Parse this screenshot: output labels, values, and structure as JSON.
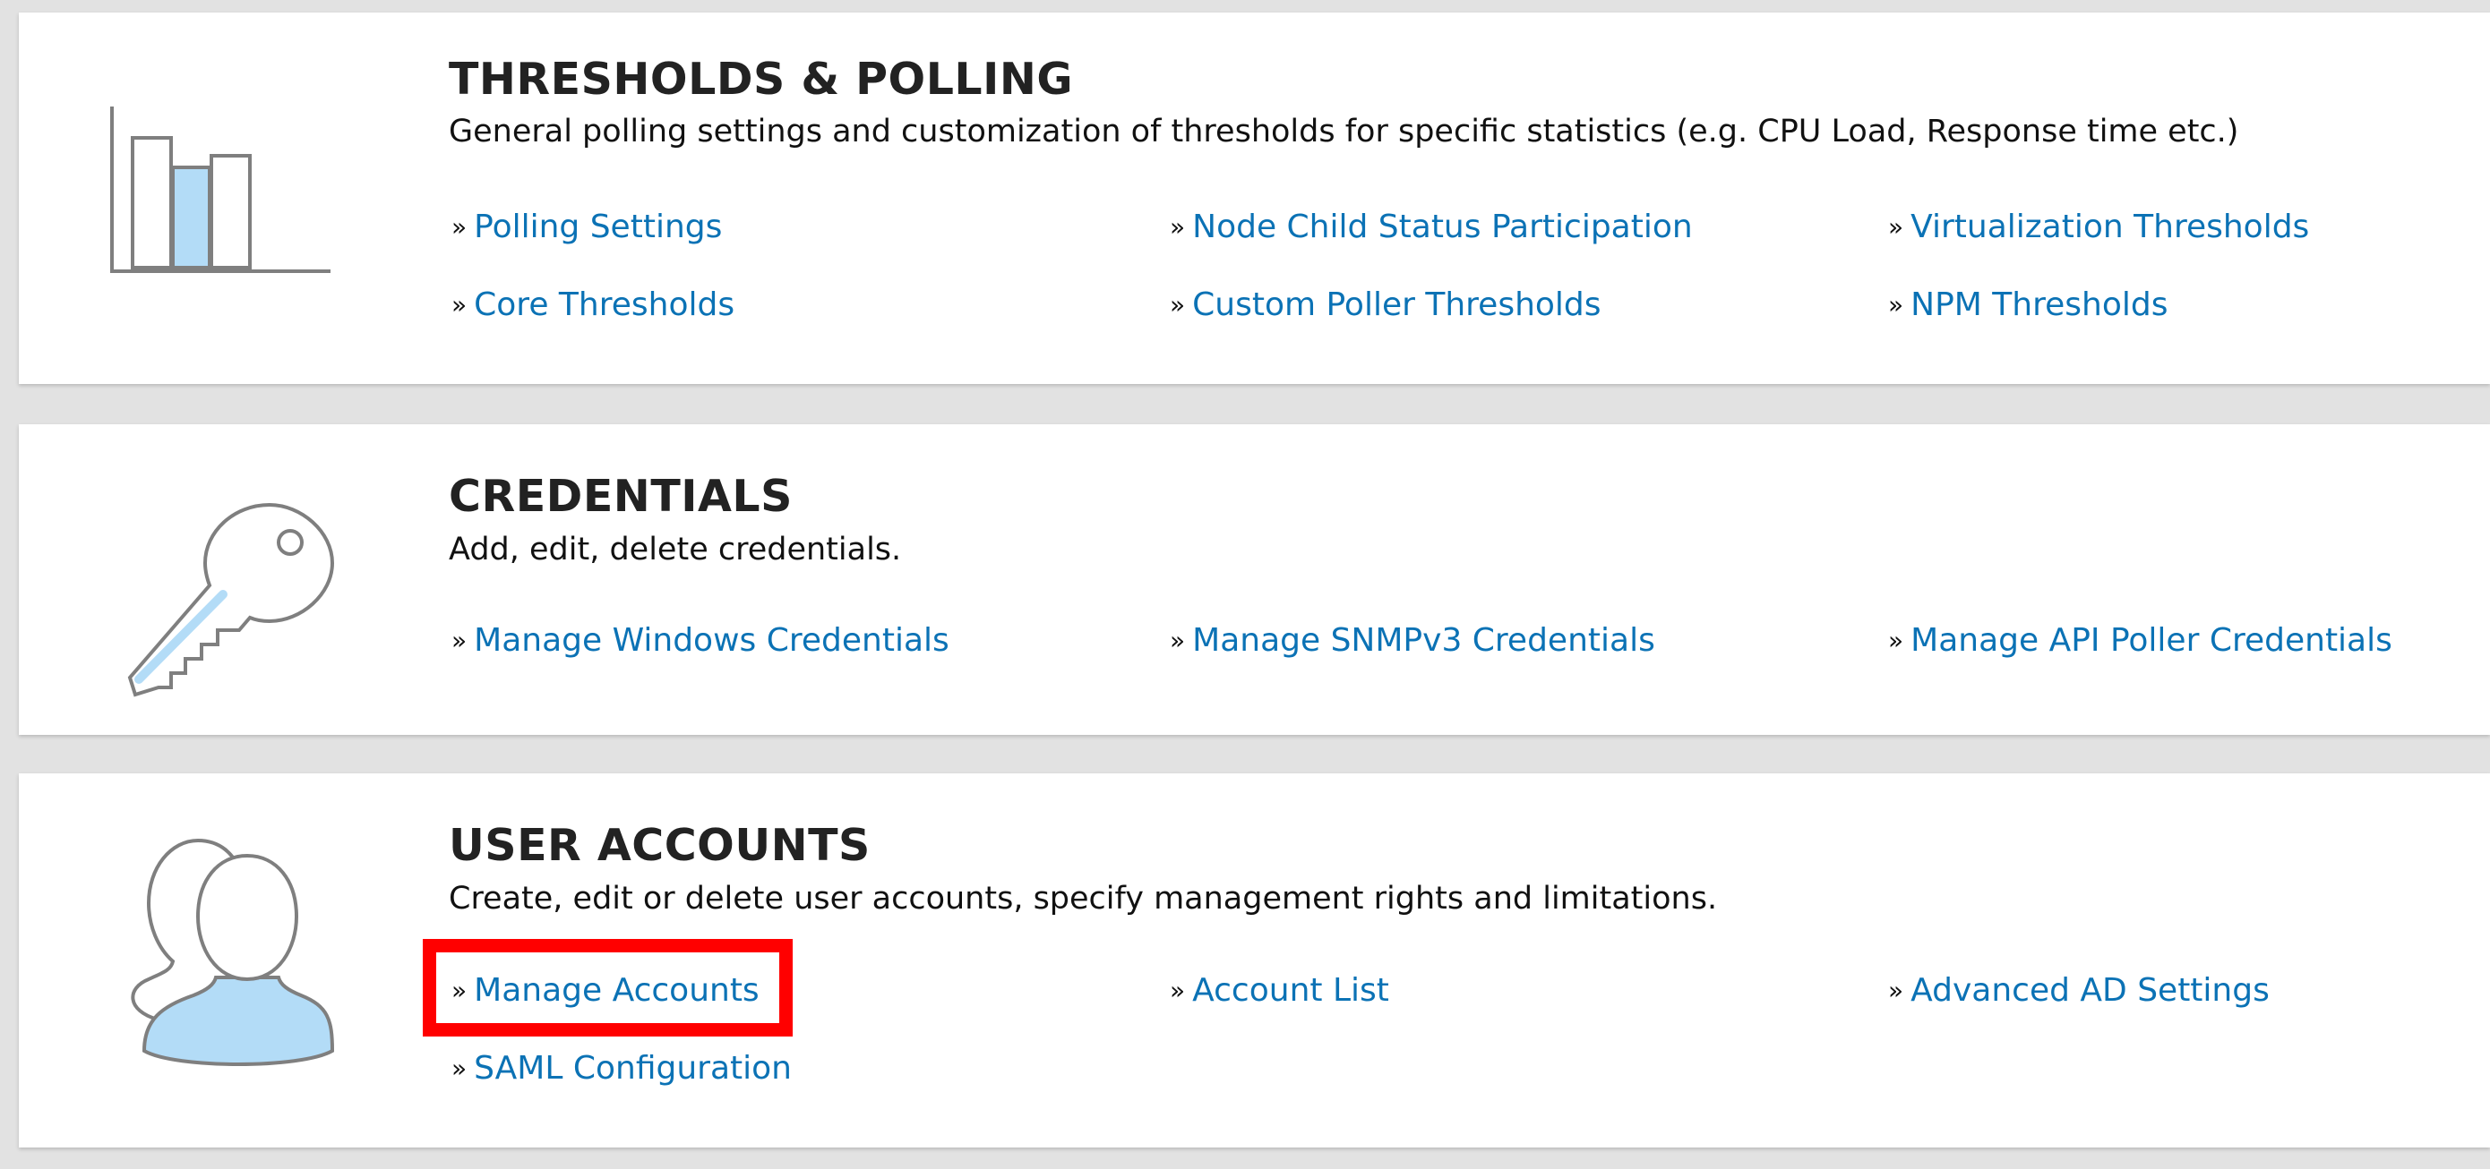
{
  "sections": [
    {
      "title": "THRESHOLDS & POLLING",
      "description": "General polling settings and customization of thresholds for specific statistics (e.g. CPU Load, Response time etc.)",
      "icon": "bar-chart-icon",
      "links": [
        "Polling Settings",
        "Node Child Status Participation",
        "Virtualization Thresholds",
        "Core Thresholds",
        "Custom Poller Thresholds",
        "NPM Thresholds"
      ]
    },
    {
      "title": "CREDENTIALS",
      "description": "Add, edit, delete credentials.",
      "icon": "key-icon",
      "links": [
        "Manage Windows Credentials",
        "Manage SNMPv3 Credentials",
        "Manage API Poller Credentials"
      ]
    },
    {
      "title": "USER ACCOUNTS",
      "description": "Create, edit or delete user accounts, specify management rights and limitations.",
      "icon": "users-icon",
      "links": [
        "Manage Accounts",
        "Account List",
        "Advanced AD Settings",
        "SAML Configuration"
      ]
    }
  ],
  "link_bullet": "»",
  "highlighted_link": "Manage Accounts",
  "colors": {
    "link": "#0b72b5",
    "icon_fill": "#b3dcf7",
    "icon_stroke": "#7f7f7f",
    "highlight": "#ff0000",
    "background": "#e2e2e2"
  }
}
